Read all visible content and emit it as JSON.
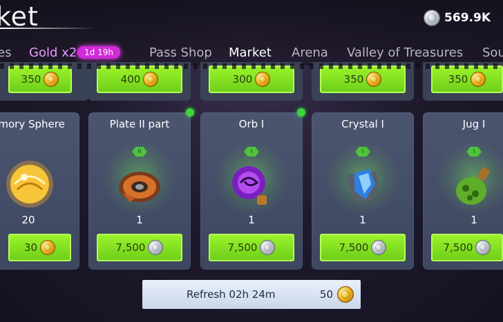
{
  "header": {
    "title": "ket",
    "currency_amount": "569.9K",
    "currency_icon": "silver-coin-icon"
  },
  "tabs": [
    {
      "label": "es"
    },
    {
      "label": "Gold x2",
      "badge": "1d 19h"
    },
    {
      "label": "Pass Shop"
    },
    {
      "label": "Market"
    },
    {
      "label": "Arena"
    },
    {
      "label": "Valley of Treasures"
    },
    {
      "label": "Sou"
    }
  ],
  "previous_row": [
    {
      "price": "350"
    },
    {
      "price": "400"
    },
    {
      "price": "300"
    },
    {
      "price": "350"
    },
    {
      "price": "350"
    }
  ],
  "items": [
    {
      "name": "emory Sphere",
      "quantity": "20",
      "price": "30",
      "currency": "gold",
      "icon": "memory-sphere-icon"
    },
    {
      "name": "Plate II part",
      "tier": "II",
      "quantity": "1",
      "price": "7,500",
      "currency": "silver",
      "icon": "plate-icon"
    },
    {
      "name": "Orb I",
      "tier": "I",
      "quantity": "1",
      "price": "7,500",
      "currency": "silver",
      "icon": "orb-icon"
    },
    {
      "name": "Crystal I",
      "tier": "I",
      "quantity": "1",
      "price": "7,500",
      "currency": "silver",
      "icon": "crystal-icon"
    },
    {
      "name": "Jug  I",
      "tier": "I",
      "quantity": "1",
      "price": "7,500",
      "currency": "silver",
      "icon": "jug-icon"
    }
  ],
  "refresh": {
    "label": "Refresh 02h 24m",
    "cost": "50"
  },
  "colors": {
    "price_green": "#8be426",
    "badge_magenta": "#d12bd9",
    "card_bg": "#454f69"
  }
}
